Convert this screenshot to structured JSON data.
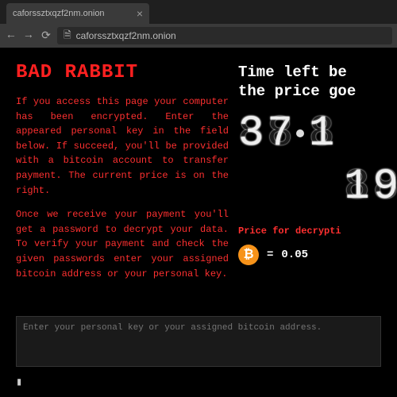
{
  "browser": {
    "tab_title": "caforssztxqzf2nm.onion",
    "tab_close": "×",
    "url": "caforssztxqzf2nm.onion",
    "nav": {
      "back": "←",
      "forward": "→",
      "reload": "⟳",
      "file_icon": "🗎"
    }
  },
  "page": {
    "title": "BAD RABBIT",
    "para1": "If you access this page your computer has been encrypted. Enter the appeared personal key in the field below. If succeed, you'll be provided with a bitcoin account to transfer payment. The current price is on the right.",
    "para2": "Once we receive your payment you'll get a password to decrypt your data. To verify your payment and check the given passwords enter your assigned bitcoin address or your personal key.",
    "timer_line1": "Time left be",
    "timer_line2": "the price goe",
    "digits_top": [
      "3",
      "7",
      "1"
    ],
    "digits_bottom": [
      "1",
      "9"
    ],
    "price_label": "Price for decrypti",
    "btc_symbol": "₿",
    "price_eq": "=",
    "price_value": "0.05",
    "input_placeholder": "Enter your personal key or your assigned bitcoin address.",
    "cursor": "▮"
  }
}
